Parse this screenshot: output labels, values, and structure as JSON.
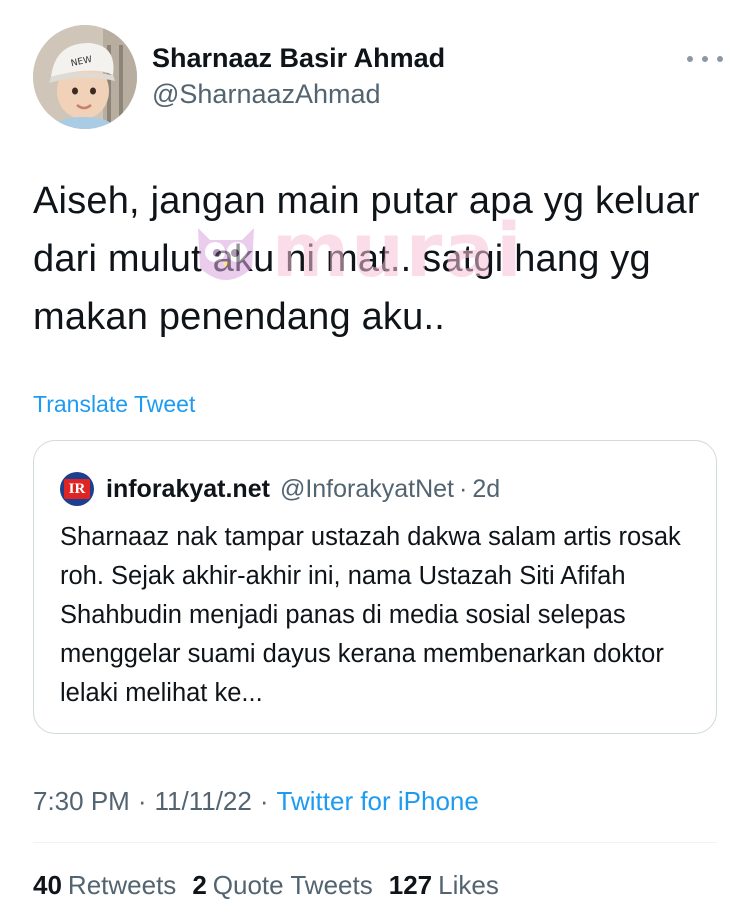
{
  "author": {
    "display_name": "Sharnaaz Basir Ahmad",
    "handle": "@SharnaazAhmad",
    "avatar_icon": "profile-photo-child-with-cap"
  },
  "more_icon": "more-horizontal-icon",
  "tweet": {
    "text": "Aiseh, jangan main putar apa yg keluar dari mulut aku ni mat.. satgi hang yg makan penendang aku..",
    "translate_label": "Translate Tweet"
  },
  "watermark": {
    "text": "murai"
  },
  "quote": {
    "logo_text": "IR",
    "name": "inforakyat.net",
    "handle": "@InforakyatNet",
    "separator": "·",
    "time": "2d",
    "body": "Sharnaaz nak tampar ustazah dakwa salam artis rosak roh. Sejak akhir-akhir ini, nama Ustazah Siti Afifah Shahbudin menjadi panas di media sosial selepas menggelar suami dayus kerana membenarkan doktor lelaki melihat ke..."
  },
  "meta": {
    "time": "7:30 PM",
    "separator": "·",
    "date": "11/11/22",
    "source": "Twitter for iPhone"
  },
  "stats": {
    "retweets_count": "40",
    "retweets_label": "Retweets",
    "quotes_count": "2",
    "quotes_label": "Quote Tweets",
    "likes_count": "127",
    "likes_label": "Likes"
  },
  "colors": {
    "link": "#1d9bf0",
    "secondary_text": "#536471",
    "primary_text": "#0f1419",
    "border": "#cfd9de",
    "watermark": "#f6c3d6"
  }
}
